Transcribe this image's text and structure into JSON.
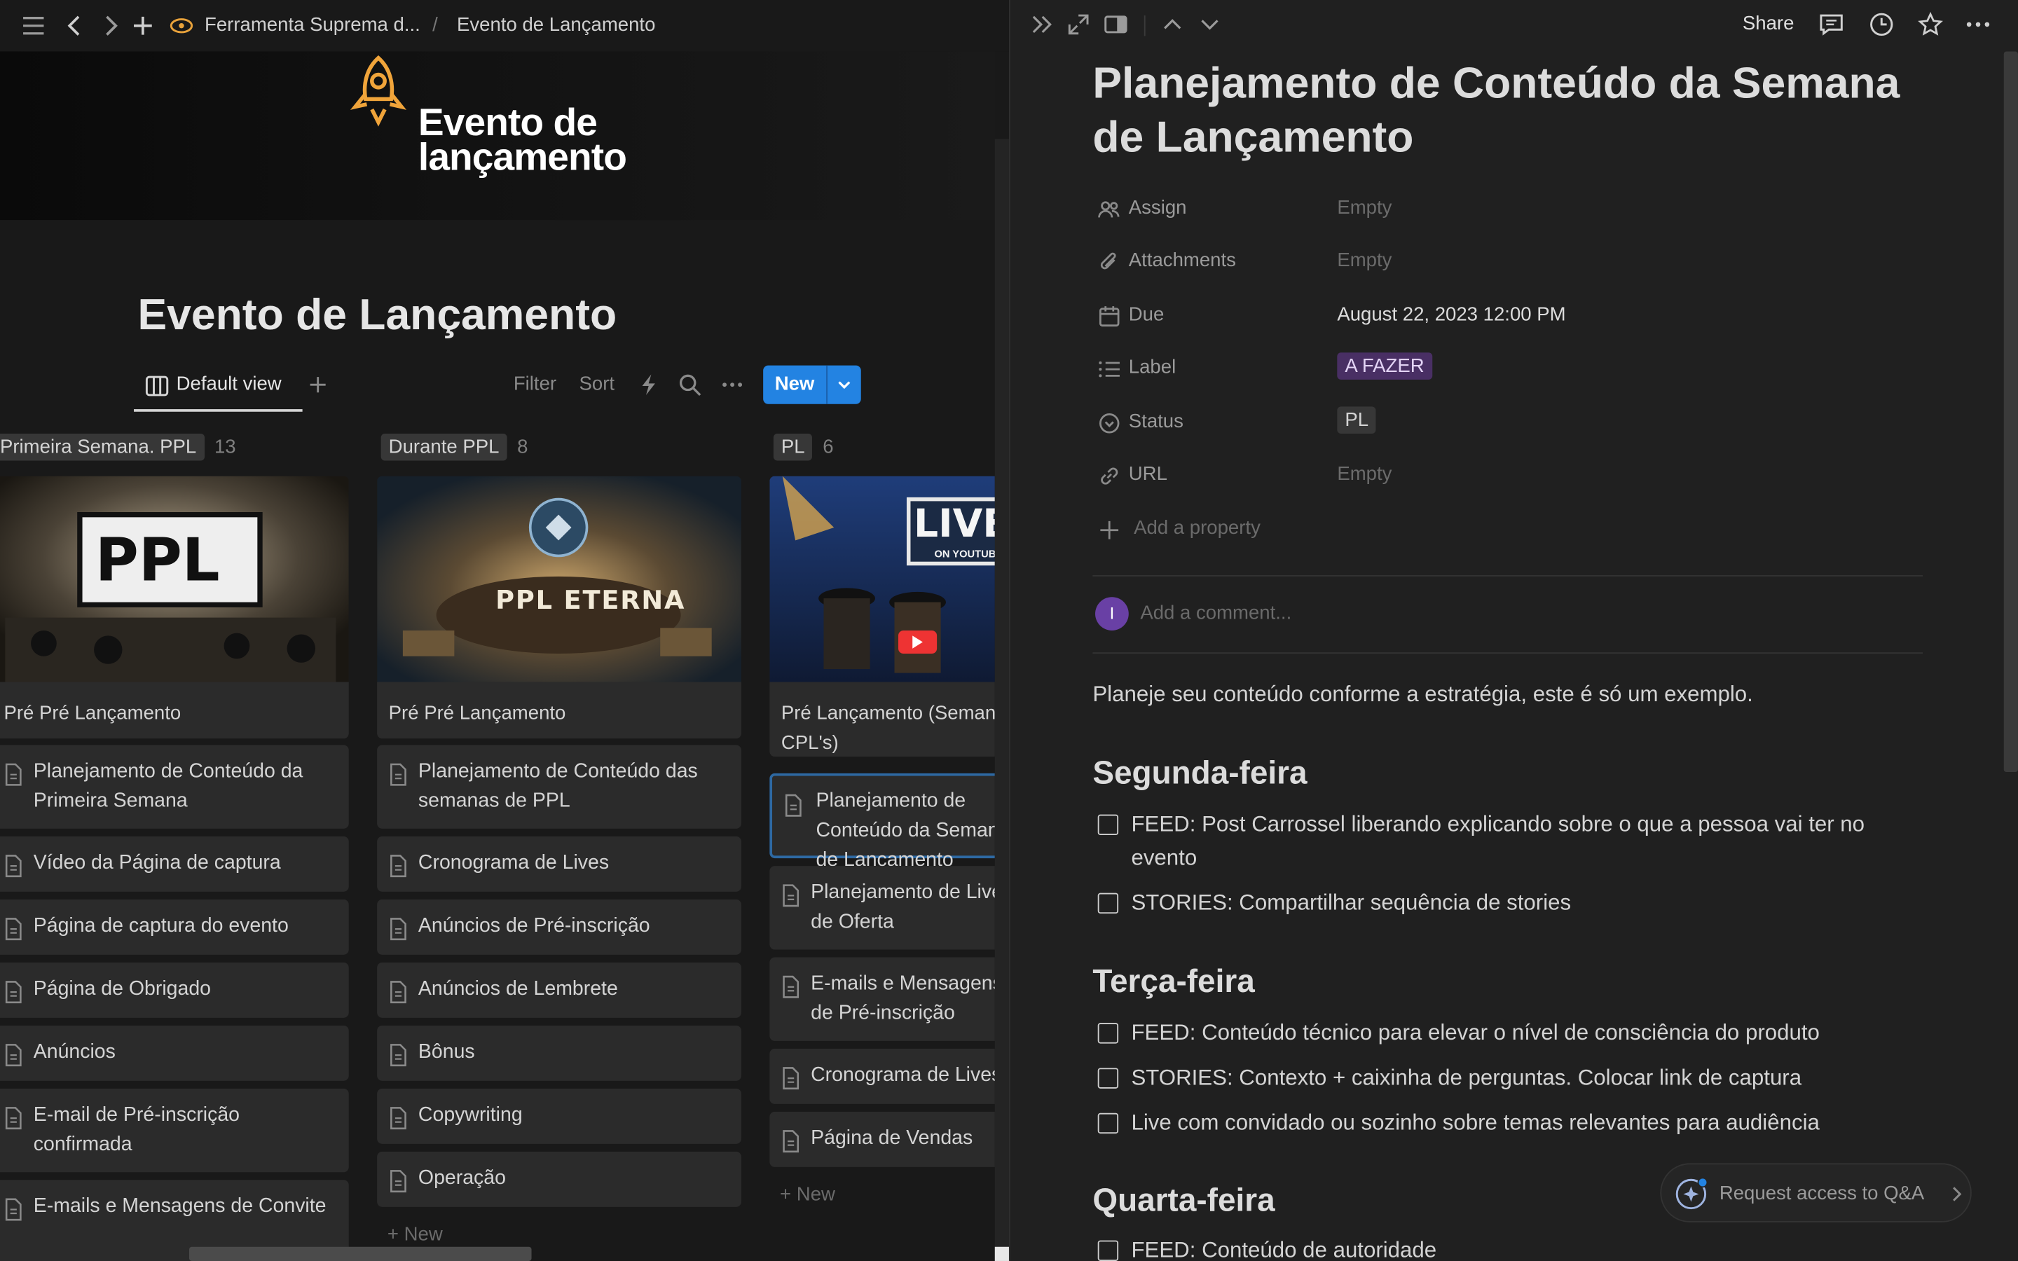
{
  "topbar": {
    "breadcrumb_workspace": "Ferramenta Suprema d...",
    "breadcrumb_sep": "/",
    "breadcrumb_page": "Evento de Lançamento"
  },
  "banner": {
    "line1": "Evento de",
    "line2": "lançamento"
  },
  "page": {
    "title": "Evento de Lançamento"
  },
  "viewbar": {
    "tab_label": "Default view",
    "filter": "Filter",
    "sort": "Sort",
    "new_label": "New"
  },
  "board": {
    "columns": [
      {
        "name": "Primeira Semana. PPL",
        "count": "13",
        "cover_text": "PPL",
        "card_title": "Pré Pré Lançamento",
        "items": [
          "Planejamento de Conteúdo da Primeira Semana",
          "Vídeo da Página de captura",
          "Página de captura do evento",
          "Página de Obrigado",
          "Anúncios",
          "E-mail de Pré-inscrição confirmada",
          "E-mails e Mensagens de Convite"
        ]
      },
      {
        "name": "Durante PPL",
        "count": "8",
        "cover_text": "PPL ETERNA",
        "card_title": "Pré Pré Lançamento",
        "items": [
          "Planejamento de Conteúdo das semanas de PPL",
          "Cronograma de Lives",
          "Anúncios de Pré-inscrição",
          "Anúncios de Lembrete",
          "Bônus",
          "Copywriting",
          "Operação"
        ],
        "new_label": "New"
      },
      {
        "name": "PL",
        "count": "6",
        "cover_text": "LIVE",
        "cover_subtext": "ON YOUTUBE",
        "card_title": "Pré Lançamento (Semana CPL's)",
        "items": [
          "Planejamento de Conteúdo da Semana de Lançamento",
          "Planejamento de Live de Oferta",
          "E-mails e Mensagens de Pré-inscrição",
          "Cronograma de Lives",
          "Página de Vendas"
        ],
        "new_label": "New"
      }
    ]
  },
  "panel": {
    "share": "Share",
    "title": "Planejamento de Conteúdo da Semana de Lançamento",
    "properties": [
      {
        "name": "Assign",
        "value": "Empty",
        "icon": "people-icon"
      },
      {
        "name": "Attachments",
        "value": "Empty",
        "icon": "paperclip-icon"
      },
      {
        "name": "Due",
        "value": "August 22, 2023 12:00 PM",
        "icon": "calendar-icon"
      },
      {
        "name": "Label",
        "value": "A FAZER",
        "icon": "list-icon"
      },
      {
        "name": "Status",
        "value": "PL",
        "icon": "status-icon"
      },
      {
        "name": "URL",
        "value": "Empty",
        "icon": "link-icon"
      }
    ],
    "add_property": "Add a property",
    "avatar_initial": "I",
    "comment_placeholder": "Add a comment...",
    "intro": "Planeje seu conteúdo conforme a estratégia, este é só um exemplo.",
    "sections": [
      {
        "heading": "Segunda-feira",
        "todos": [
          "FEED: Post Carrossel liberando explicando sobre o que a pessoa vai ter no evento",
          "STORIES: Compartilhar sequência de stories"
        ]
      },
      {
        "heading": "Terça-feira",
        "todos": [
          "FEED: Conteúdo técnico para elevar o nível de consciência do produto",
          "STORIES: Contexto + caixinha de perguntas. Colocar link de captura",
          "Live com convidado ou sozinho sobre temas relevantes para audiência"
        ]
      },
      {
        "heading": "Quarta-feira",
        "todos": [
          "FEED: Conteúdo de autoridade"
        ]
      }
    ],
    "request_access": "Request access to Q&A"
  },
  "colors": {
    "accent": "#2383e2",
    "label_purple": "#492f64",
    "bg": "#191919",
    "panel_bg": "#202020"
  }
}
